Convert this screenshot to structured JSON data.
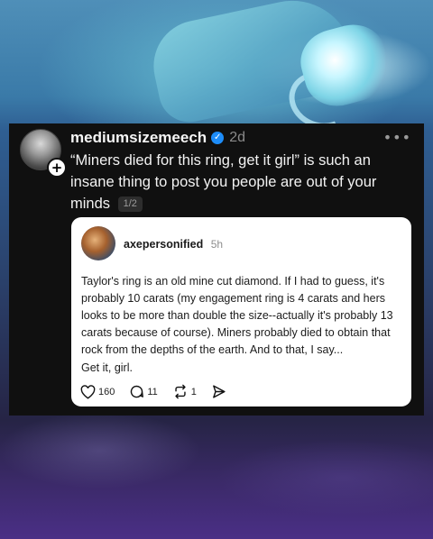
{
  "post": {
    "username": "mediumsizemeech",
    "time": "2d",
    "text": "“Miners died for this ring, get it girl” is such an insane thing to post you people are out of your minds",
    "page_indicator": "1/2",
    "more_icon": "more-horizontal-icon",
    "verified_icon": "verified-badge-icon"
  },
  "quoted_post": {
    "username": "axepersonified",
    "time": "5h",
    "text": "Taylor's ring is an old mine cut diamond. If I had to guess, it's probably 10 carats (my engagement ring is 4 carats and hers looks to be more than double the size--actually it's probably 13 carats because of course). Miners probably died to obtain that rock from the depths of the earth. And to that, I say...",
    "closing": "Get it, girl.",
    "likes": "160",
    "replies": "11",
    "reposts": "1"
  },
  "colors": {
    "post_background": "#101010",
    "quote_background": "#ffffff",
    "verified_blue": "#1d8cf8"
  }
}
